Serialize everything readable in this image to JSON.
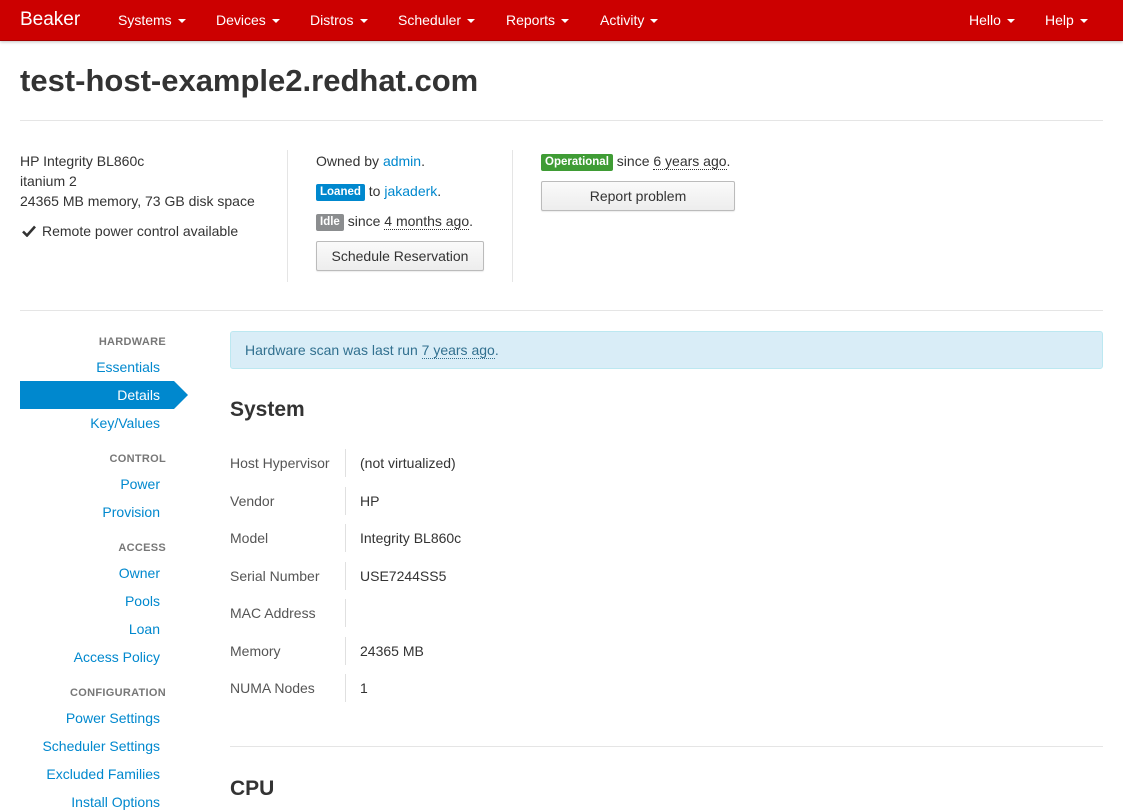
{
  "navbar": {
    "brand": "Beaker",
    "items": [
      "Systems",
      "Devices",
      "Distros",
      "Scheduler",
      "Reports",
      "Activity"
    ],
    "right_items": [
      "Hello",
      "Help"
    ]
  },
  "page": {
    "title": "test-host-example2.redhat.com"
  },
  "summary": {
    "hardware": {
      "model_line": "HP Integrity BL860c",
      "arch": "itanium 2",
      "memory_disk": "24365 MB memory, 73 GB disk space",
      "power": "Remote power control available"
    },
    "ownership": {
      "owned_by_prefix": "Owned by",
      "owner": "admin",
      "loaned_badge": "Loaned",
      "loaned_to_prefix": "to",
      "loanee": "jakaderk",
      "idle_badge": "Idle",
      "idle_since_prefix": "since",
      "idle_since": "4 months ago",
      "schedule_button": "Schedule Reservation"
    },
    "status": {
      "badge": "Operational",
      "since_prefix": "since",
      "since": "6 years ago",
      "report_button": "Report problem"
    }
  },
  "sidebar": {
    "hardware_heading": "HARDWARE",
    "hardware_items": [
      "Essentials",
      "Details",
      "Key/Values"
    ],
    "control_heading": "CONTROL",
    "control_items": [
      "Power",
      "Provision"
    ],
    "access_heading": "ACCESS",
    "access_items": [
      "Owner",
      "Pools",
      "Loan",
      "Access Policy"
    ],
    "configuration_heading": "CONFIGURATION",
    "configuration_items": [
      "Power Settings",
      "Scheduler Settings",
      "Excluded Families",
      "Install Options"
    ]
  },
  "main": {
    "alert_prefix": "Hardware scan was last run",
    "alert_time": "7 years ago",
    "system_title": "System",
    "system_rows": [
      {
        "label": "Host Hypervisor",
        "value": "(not virtualized)"
      },
      {
        "label": "Vendor",
        "value": "HP"
      },
      {
        "label": "Model",
        "value": "Integrity BL860c"
      },
      {
        "label": "Serial Number",
        "value": "USE7244SS5"
      },
      {
        "label": "MAC Address",
        "value": ""
      },
      {
        "label": "Memory",
        "value": "24365 MB"
      },
      {
        "label": "NUMA Nodes",
        "value": "1"
      }
    ],
    "cpu_title": "CPU"
  },
  "colors": {
    "navbar": "#cc0000",
    "link": "#0088ce",
    "operational": "#3f9c35",
    "loaned": "#0088ce",
    "idle": "#8b8d8f",
    "alert_bg": "#d9edf7"
  }
}
